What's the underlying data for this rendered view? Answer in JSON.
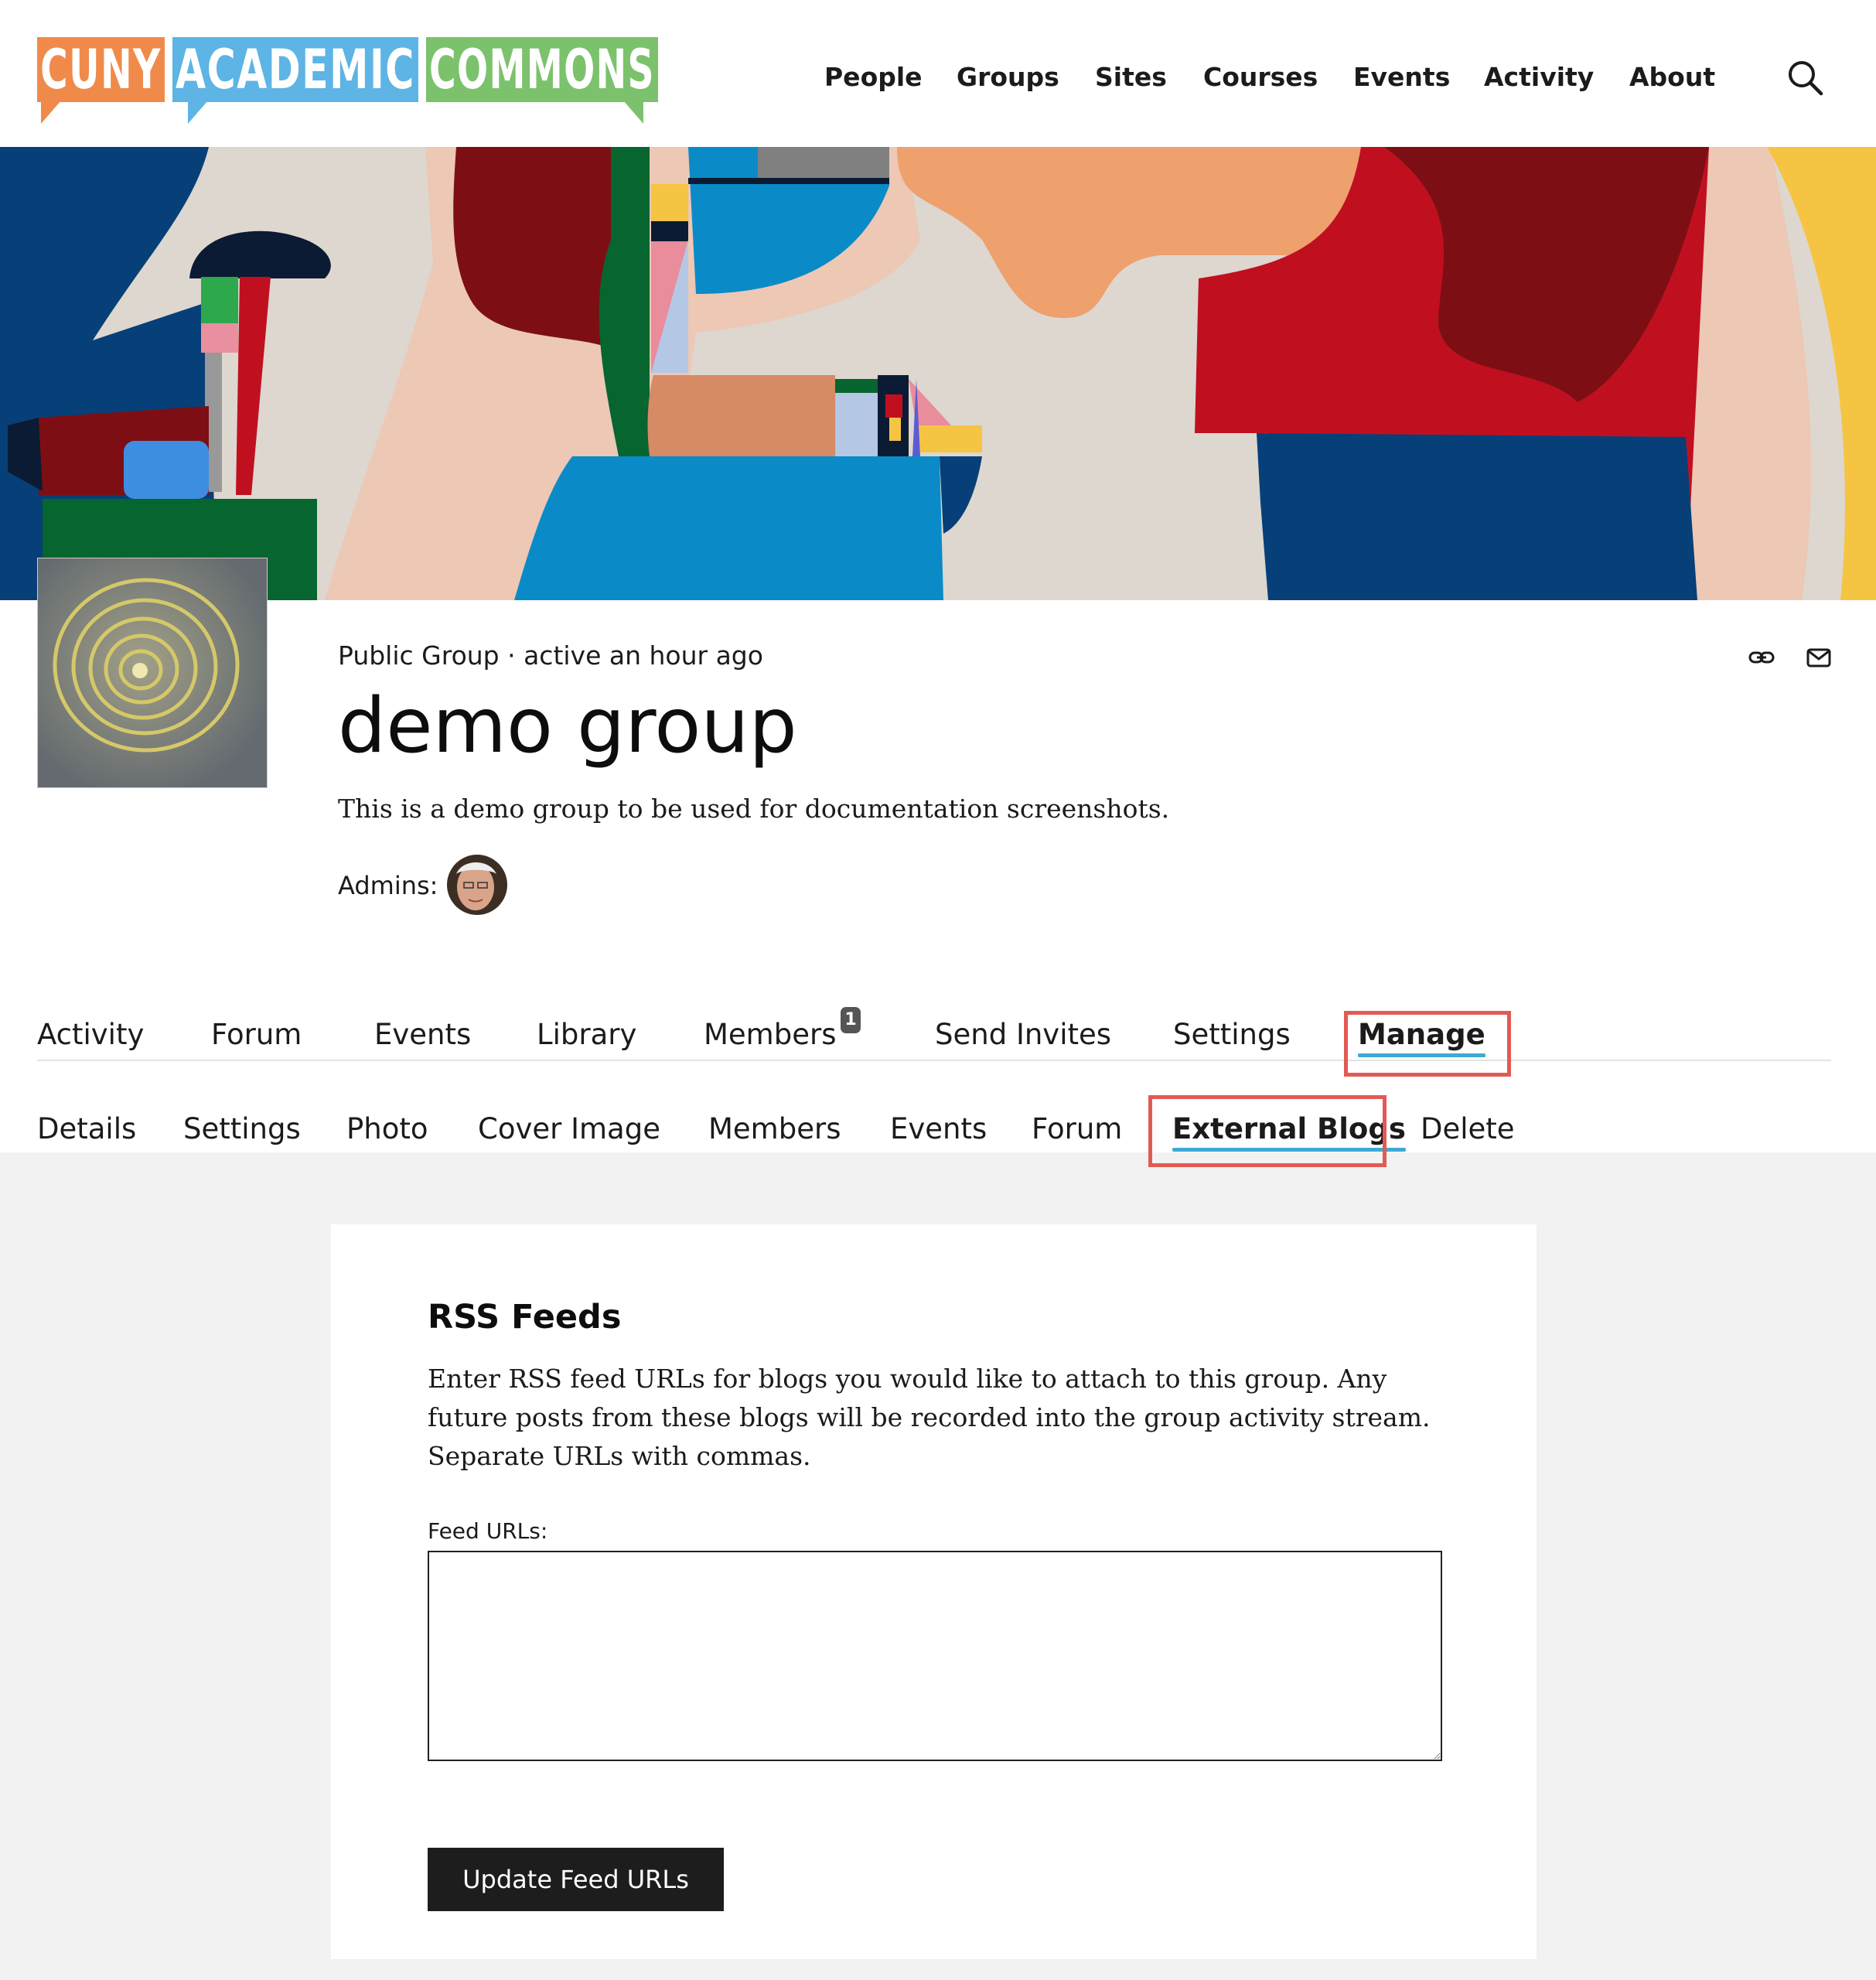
{
  "logo": {
    "words": [
      "CUNY",
      "ACADEMIC",
      "COMMONS"
    ],
    "colors": [
      "#f08a4b",
      "#5db4e5",
      "#7cc26c"
    ]
  },
  "nav": {
    "items": [
      "People",
      "Groups",
      "Sites",
      "Courses",
      "Events",
      "Activity",
      "About"
    ]
  },
  "group": {
    "meta": "Public Group · active an hour ago",
    "title": "demo group",
    "description": "This is a demo group to be used for documentation screenshots.",
    "admins_label": "Admins:"
  },
  "tabs": {
    "items": [
      "Activity",
      "Forum",
      "Events",
      "Library",
      "Members",
      "Send Invites",
      "Settings",
      "Manage"
    ],
    "members_count": "1",
    "active": "Manage"
  },
  "subnav": {
    "items": [
      "Details",
      "Settings",
      "Photo",
      "Cover Image",
      "Members",
      "Events",
      "Forum",
      "External Blogs",
      "Delete"
    ],
    "active": "External Blogs"
  },
  "rss": {
    "heading": "RSS Feeds",
    "help": "Enter RSS feed URLs for blogs you would like to attach to this group. Any future posts from these blogs will be recorded into the group activity stream. Separate URLs with commas.",
    "field_label": "Feed URLs:",
    "field_value": "",
    "button": "Update Feed URLs"
  },
  "colors": {
    "accent_underline": "#3fa9d6",
    "highlight": "#e25a53",
    "button_bg": "#1d1d1d"
  }
}
